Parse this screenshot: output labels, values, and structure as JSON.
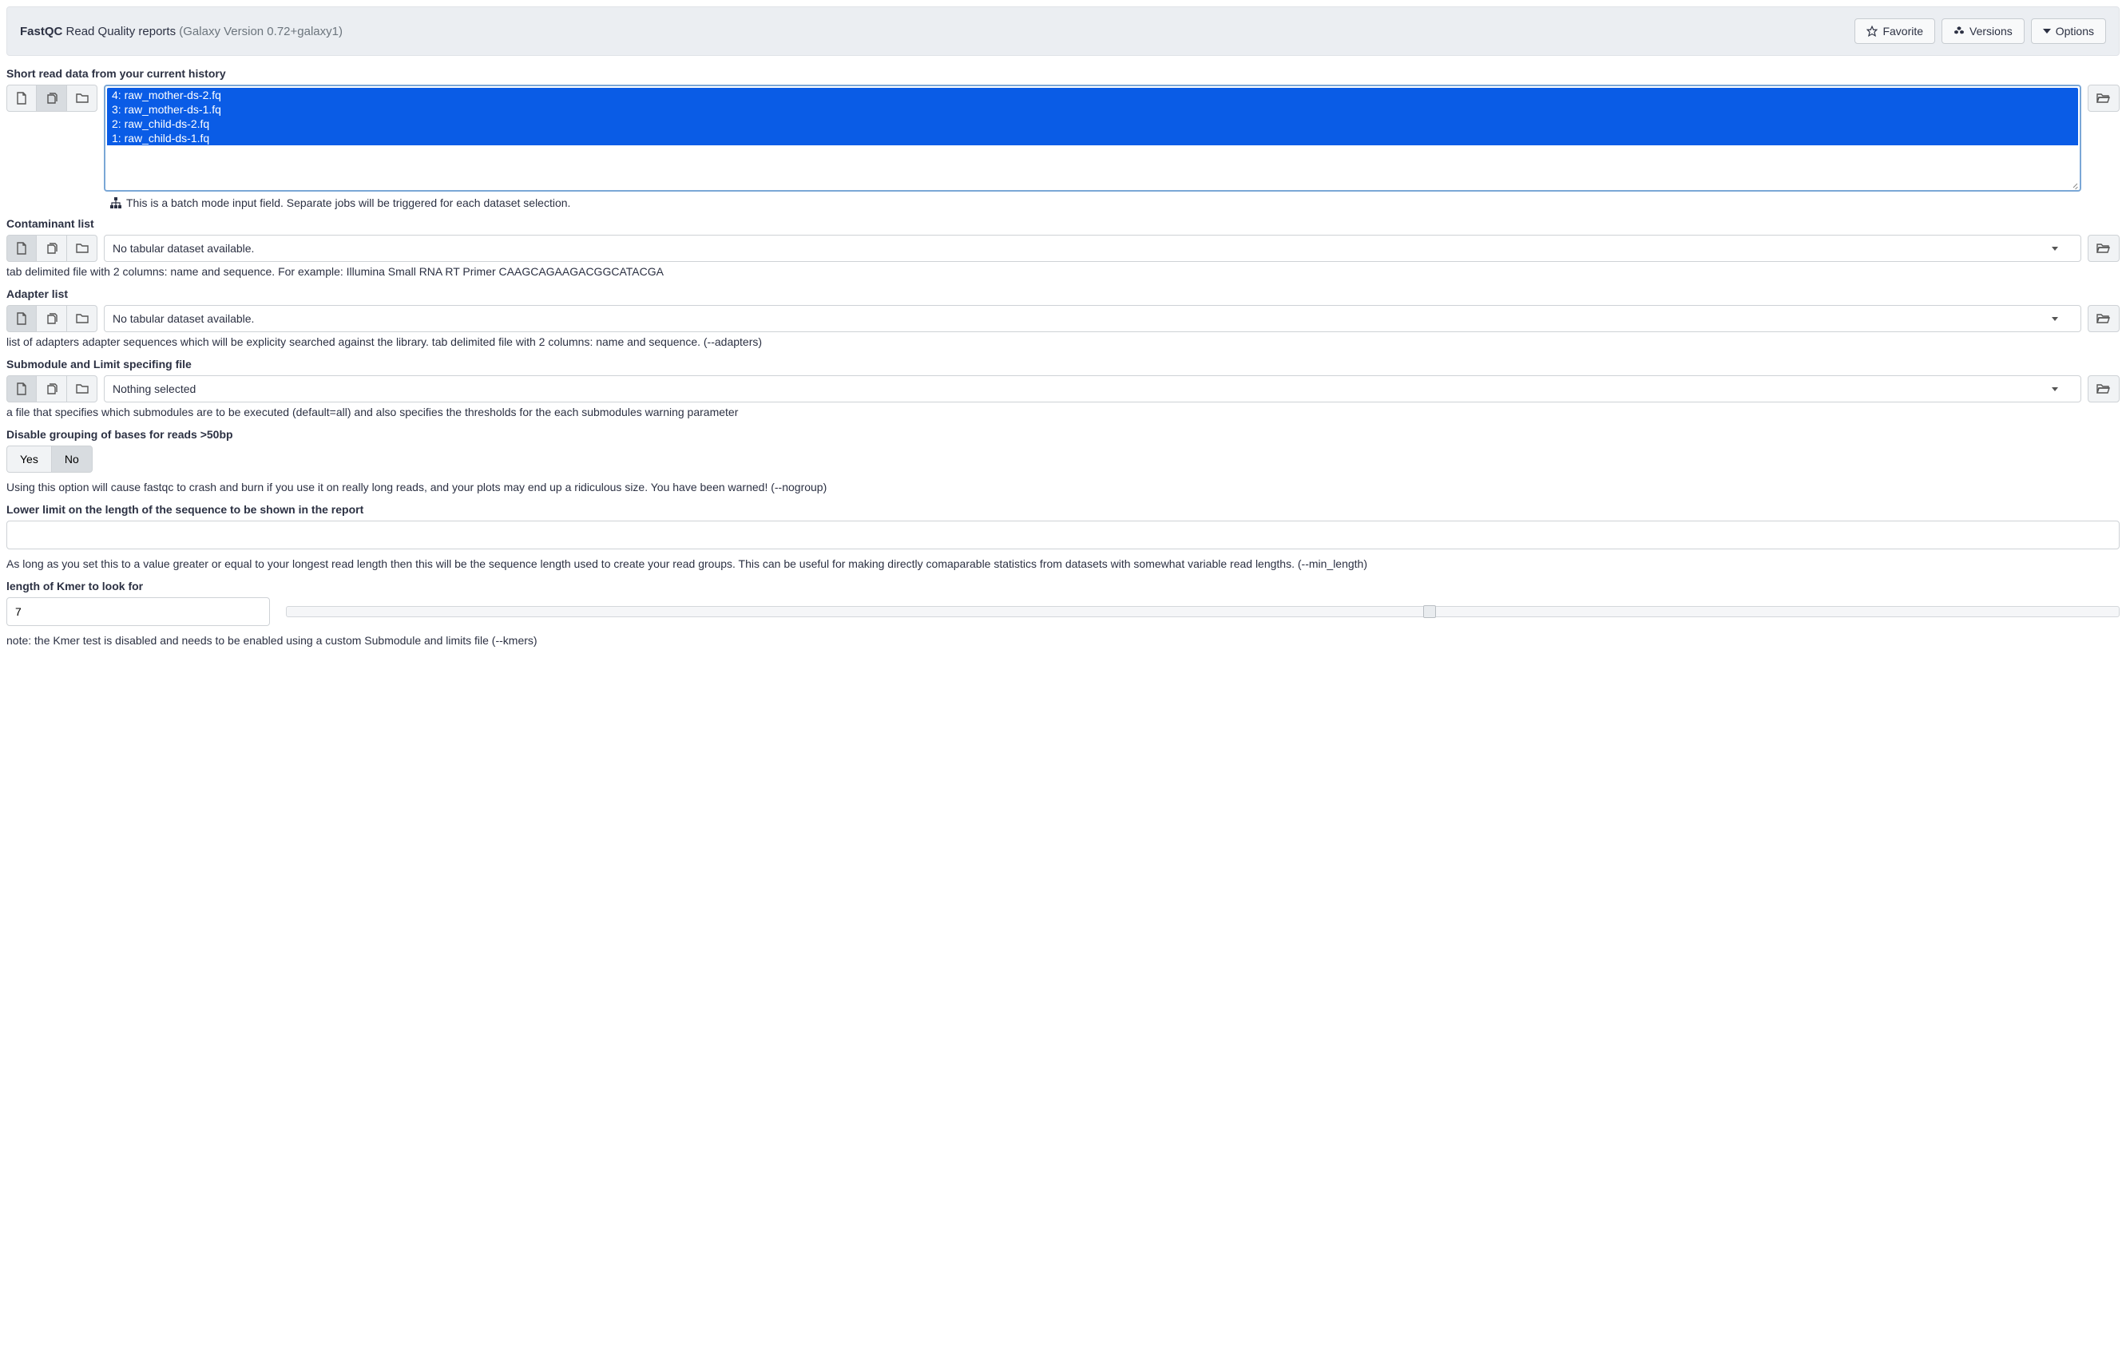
{
  "header": {
    "tool_name": "FastQC",
    "subtitle": "Read Quality reports",
    "version_text": "(Galaxy Version 0.72+galaxy1)",
    "favorite": "Favorite",
    "versions": "Versions",
    "options": "Options"
  },
  "params": {
    "short_read": {
      "label": "Short read data from your current history",
      "items": [
        "4: raw_mother-ds-2.fq",
        "3: raw_mother-ds-1.fq",
        "2: raw_child-ds-2.fq",
        "1: raw_child-ds-1.fq"
      ],
      "batch_help": "This is a batch mode input field. Separate jobs will be triggered for each dataset selection."
    },
    "contaminant": {
      "label": "Contaminant list",
      "value": "No tabular dataset available.",
      "help": "tab delimited file with 2 columns: name and sequence. For example: Illumina Small RNA RT Primer CAAGCAGAAGACGGCATACGA"
    },
    "adapter": {
      "label": "Adapter list",
      "value": "No tabular dataset available.",
      "help": "list of adapters adapter sequences which will be explicity searched against the library. tab delimited file with 2 columns: name and sequence. (--adapters)"
    },
    "submodule": {
      "label": "Submodule and Limit specifing file",
      "value": "Nothing selected",
      "help": "a file that specifies which submodules are to be executed (default=all) and also specifies the thresholds for the each submodules warning parameter"
    },
    "nogroup": {
      "label": "Disable grouping of bases for reads >50bp",
      "yes": "Yes",
      "no": "No",
      "help": "Using this option will cause fastqc to crash and burn if you use it on really long reads, and your plots may end up a ridiculous size. You have been warned! (--nogroup)"
    },
    "min_length": {
      "label": "Lower limit on the length of the sequence to be shown in the report",
      "value": "",
      "help": "As long as you set this to a value greater or equal to your longest read length then this will be the sequence length used to create your read groups. This can be useful for making directly comaparable statistics from datasets with somewhat variable read lengths. (--min_length)"
    },
    "kmer": {
      "label": "length of Kmer to look for",
      "value": "7",
      "slider_percent": 62,
      "help": "note: the Kmer test is disabled and needs to be enabled using a custom Submodule and limits file (--kmers)"
    }
  }
}
